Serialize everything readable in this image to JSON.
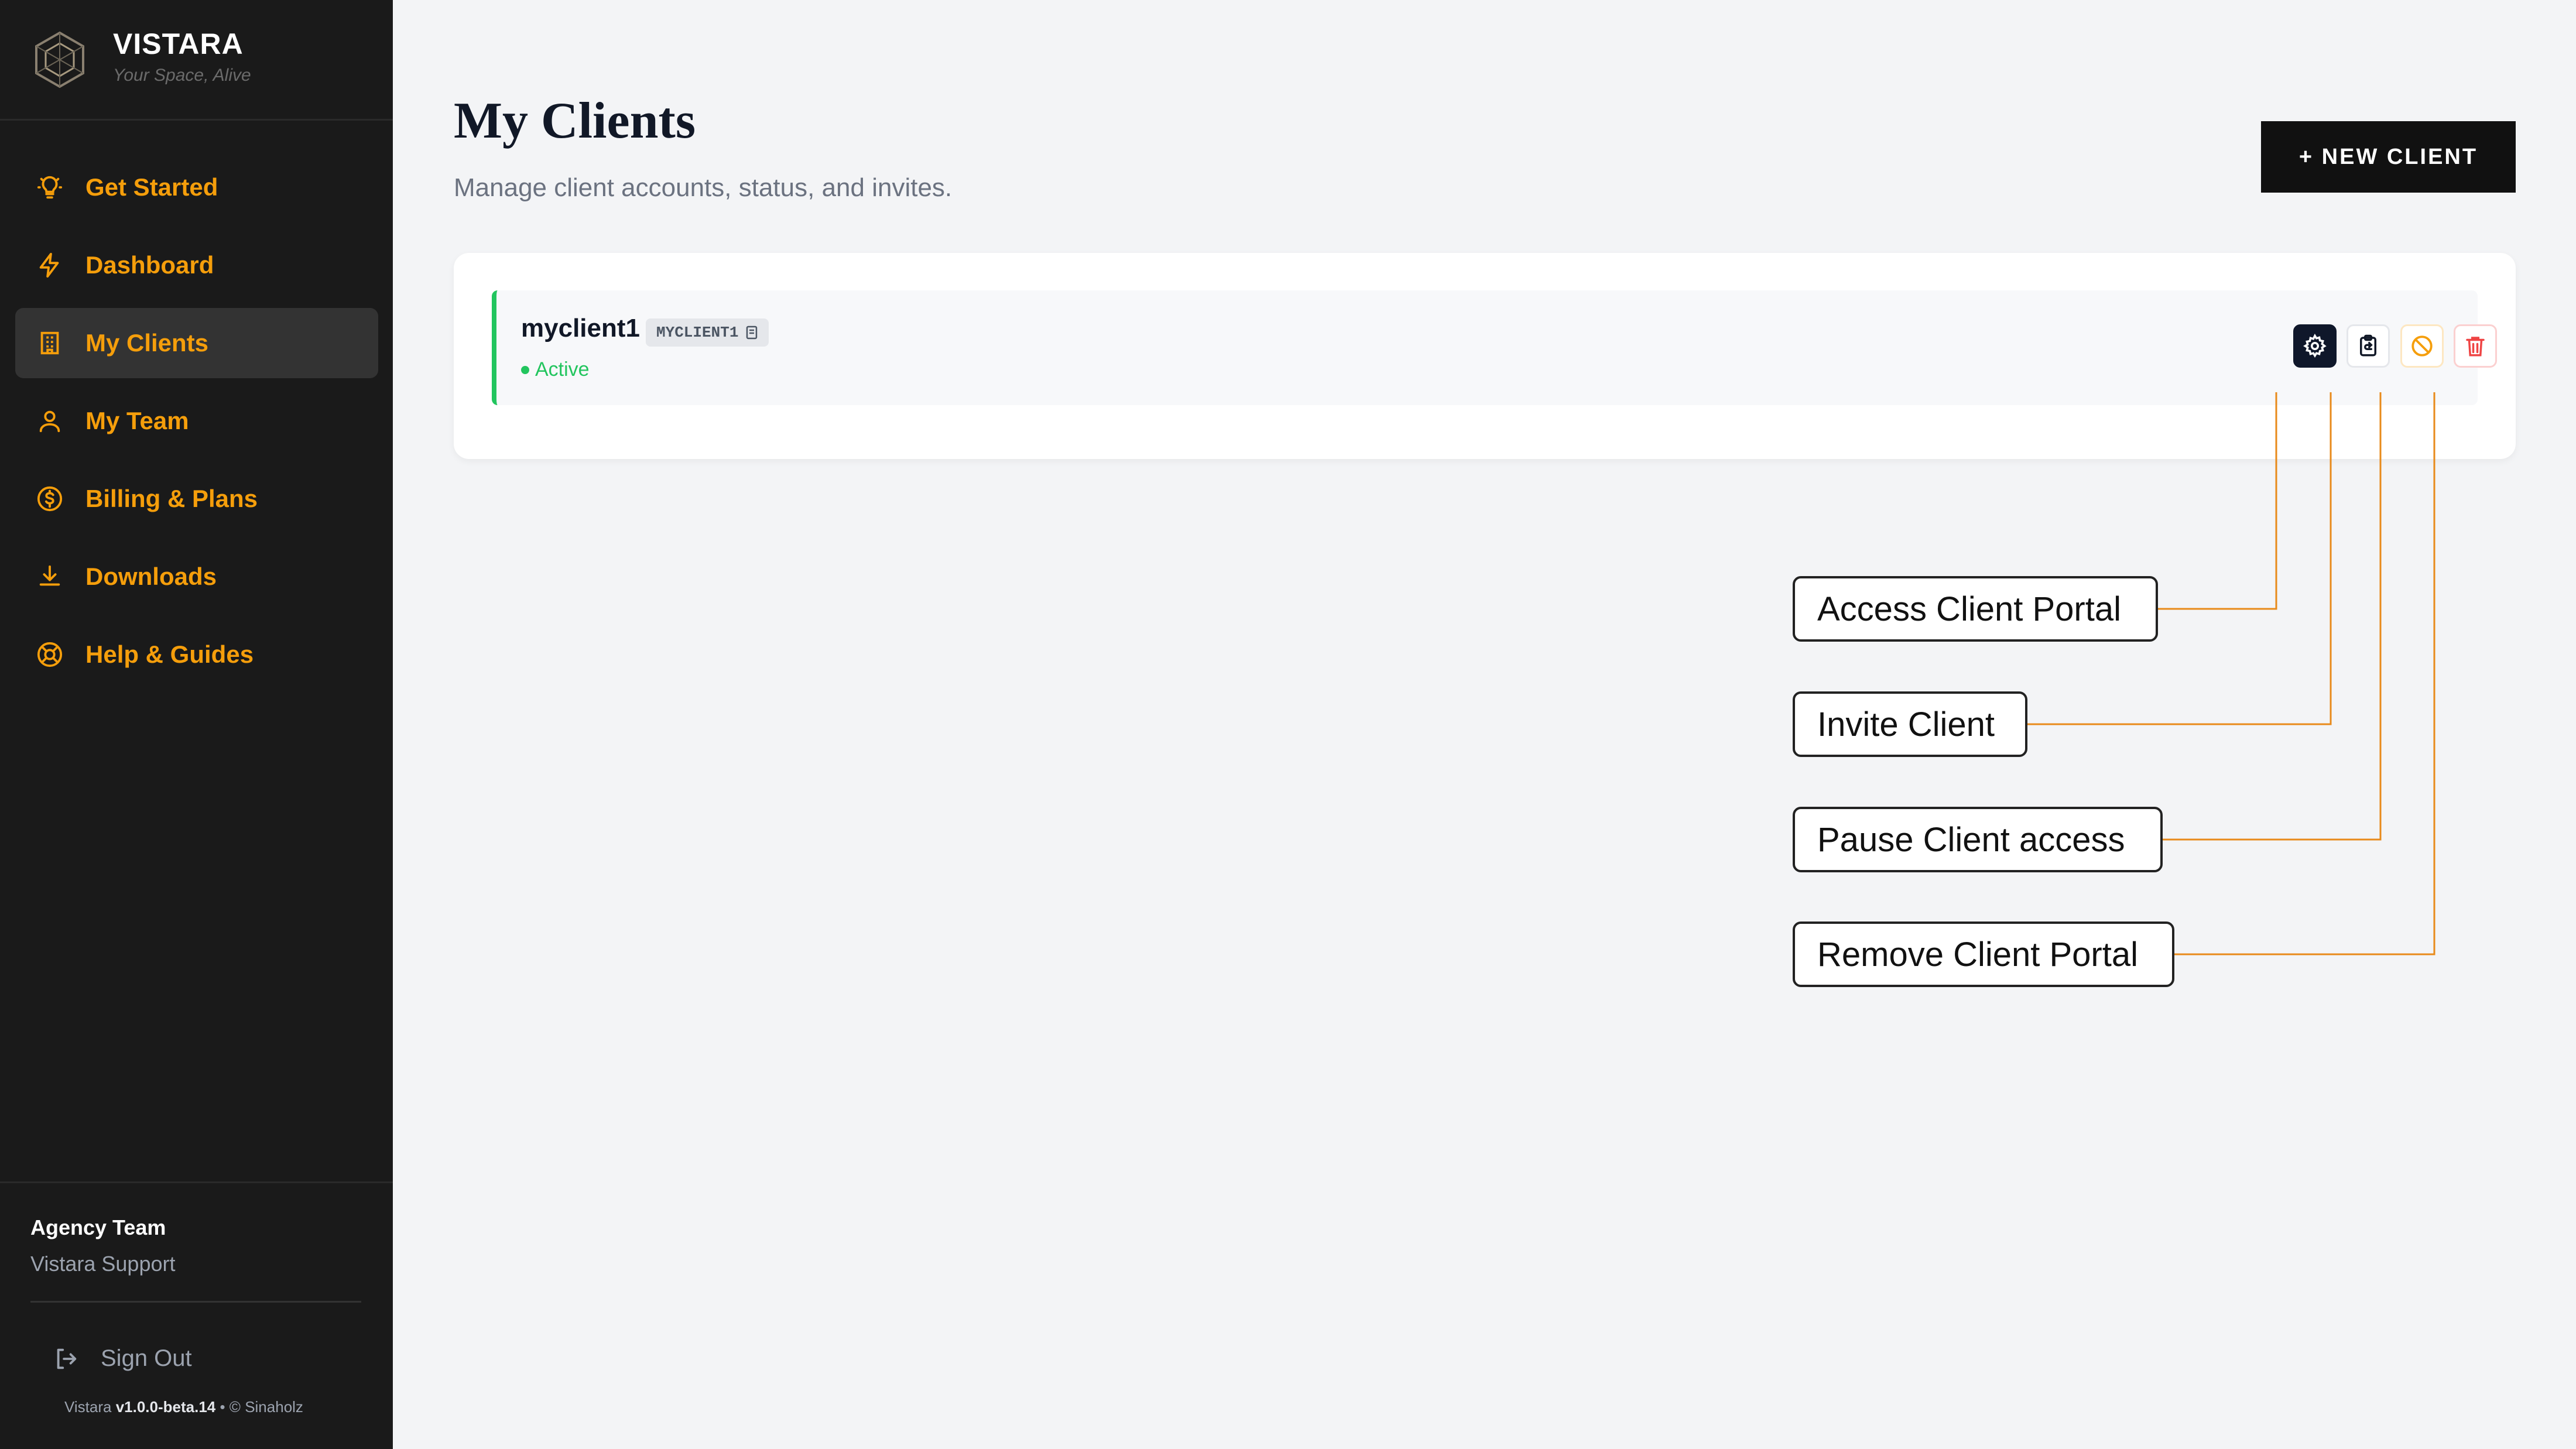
{
  "brand": {
    "name": "VISTARA",
    "tagline": "Your Space, Alive"
  },
  "sidebar": {
    "items": [
      {
        "label": "Get Started",
        "icon": "lightbulb-icon",
        "active": false
      },
      {
        "label": "Dashboard",
        "icon": "lightning-icon",
        "active": false
      },
      {
        "label": "My Clients",
        "icon": "building-icon",
        "active": true
      },
      {
        "label": "My Team",
        "icon": "users-icon",
        "active": false
      },
      {
        "label": "Billing & Plans",
        "icon": "dollar-circle-icon",
        "active": false
      },
      {
        "label": "Downloads",
        "icon": "download-icon",
        "active": false
      },
      {
        "label": "Help & Guides",
        "icon": "lifebuoy-icon",
        "active": false
      }
    ],
    "team_title": "Agency Team",
    "team_sub": "Vistara Support",
    "signout_label": "Sign Out",
    "version_prefix": "Vistara",
    "version": "v1.0.0-beta.14",
    "version_suffix": "• © Sinaholz"
  },
  "main": {
    "title": "My Clients",
    "subtitle": "Manage client accounts, status, and invites.",
    "new_button": "+ NEW CLIENT",
    "clients": [
      {
        "name": "myclient1",
        "code": "MYCLIENT1",
        "status": "Active"
      }
    ]
  },
  "annotations": {
    "access": "Access Client Portal",
    "invite": "Invite Client",
    "pause": "Pause Client access",
    "remove": "Remove Client Portal"
  },
  "colors": {
    "accent": "#f59e0b",
    "sidebar_bg": "#1a1a1a",
    "active_status": "#22c55e",
    "danger": "#ef4444",
    "annotation_line": "#e88a1a"
  }
}
